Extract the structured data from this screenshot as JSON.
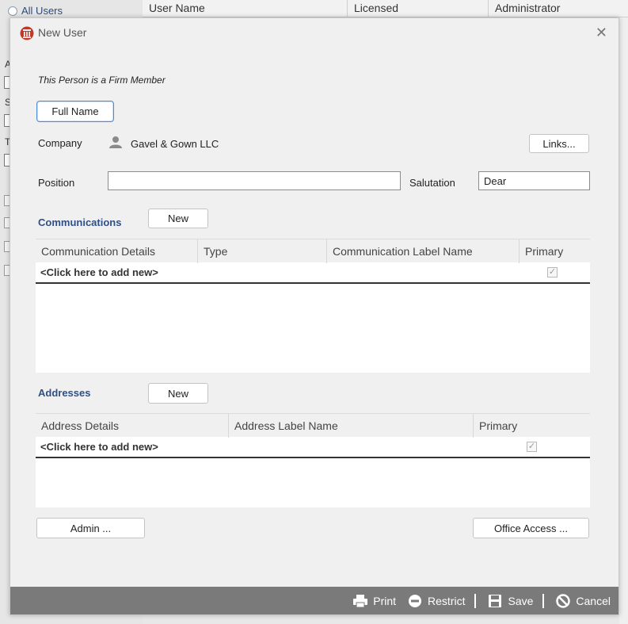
{
  "background": {
    "radio_label": "All Users",
    "columns": [
      "User Name",
      "Licensed",
      "Administrator"
    ],
    "side_letters": [
      "A",
      "S",
      "T"
    ]
  },
  "dialog": {
    "title": "New User",
    "firm_member_text": "This Person is a Firm Member",
    "full_name_button": "Full Name",
    "company_label": "Company",
    "company_name": "Gavel & Gown LLC",
    "links_button": "Links...",
    "position_label": "Position",
    "position_value": "",
    "salutation_label": "Salutation",
    "salutation_value": "Dear",
    "communications": {
      "title": "Communications",
      "new_button": "New",
      "columns": [
        "Communication Details",
        "Type",
        "Communication Label Name",
        "Primary"
      ],
      "add_new_text": "<Click here to add new>",
      "primary_checked": true
    },
    "addresses": {
      "title": "Addresses",
      "new_button": "New",
      "columns": [
        "Address Details",
        "Address Label Name",
        "Primary"
      ],
      "add_new_text": "<Click here to add new>",
      "primary_checked": true
    },
    "admin_button": "Admin ...",
    "office_access_button": "Office Access ...",
    "footer": {
      "print": "Print",
      "restrict": "Restrict",
      "save": "Save",
      "cancel": "Cancel"
    }
  },
  "icons": {
    "logo": "app-logo-icon",
    "close": "close-icon",
    "person": "person-icon",
    "print": "printer-icon",
    "restrict": "restrict-icon",
    "save": "save-icon",
    "cancel": "cancel-icon"
  },
  "colors": {
    "section_title": "#2f4f86",
    "footer_bg": "#7a7a7a",
    "focus_border": "#4f8ad4",
    "logo_red": "#c0392b"
  }
}
